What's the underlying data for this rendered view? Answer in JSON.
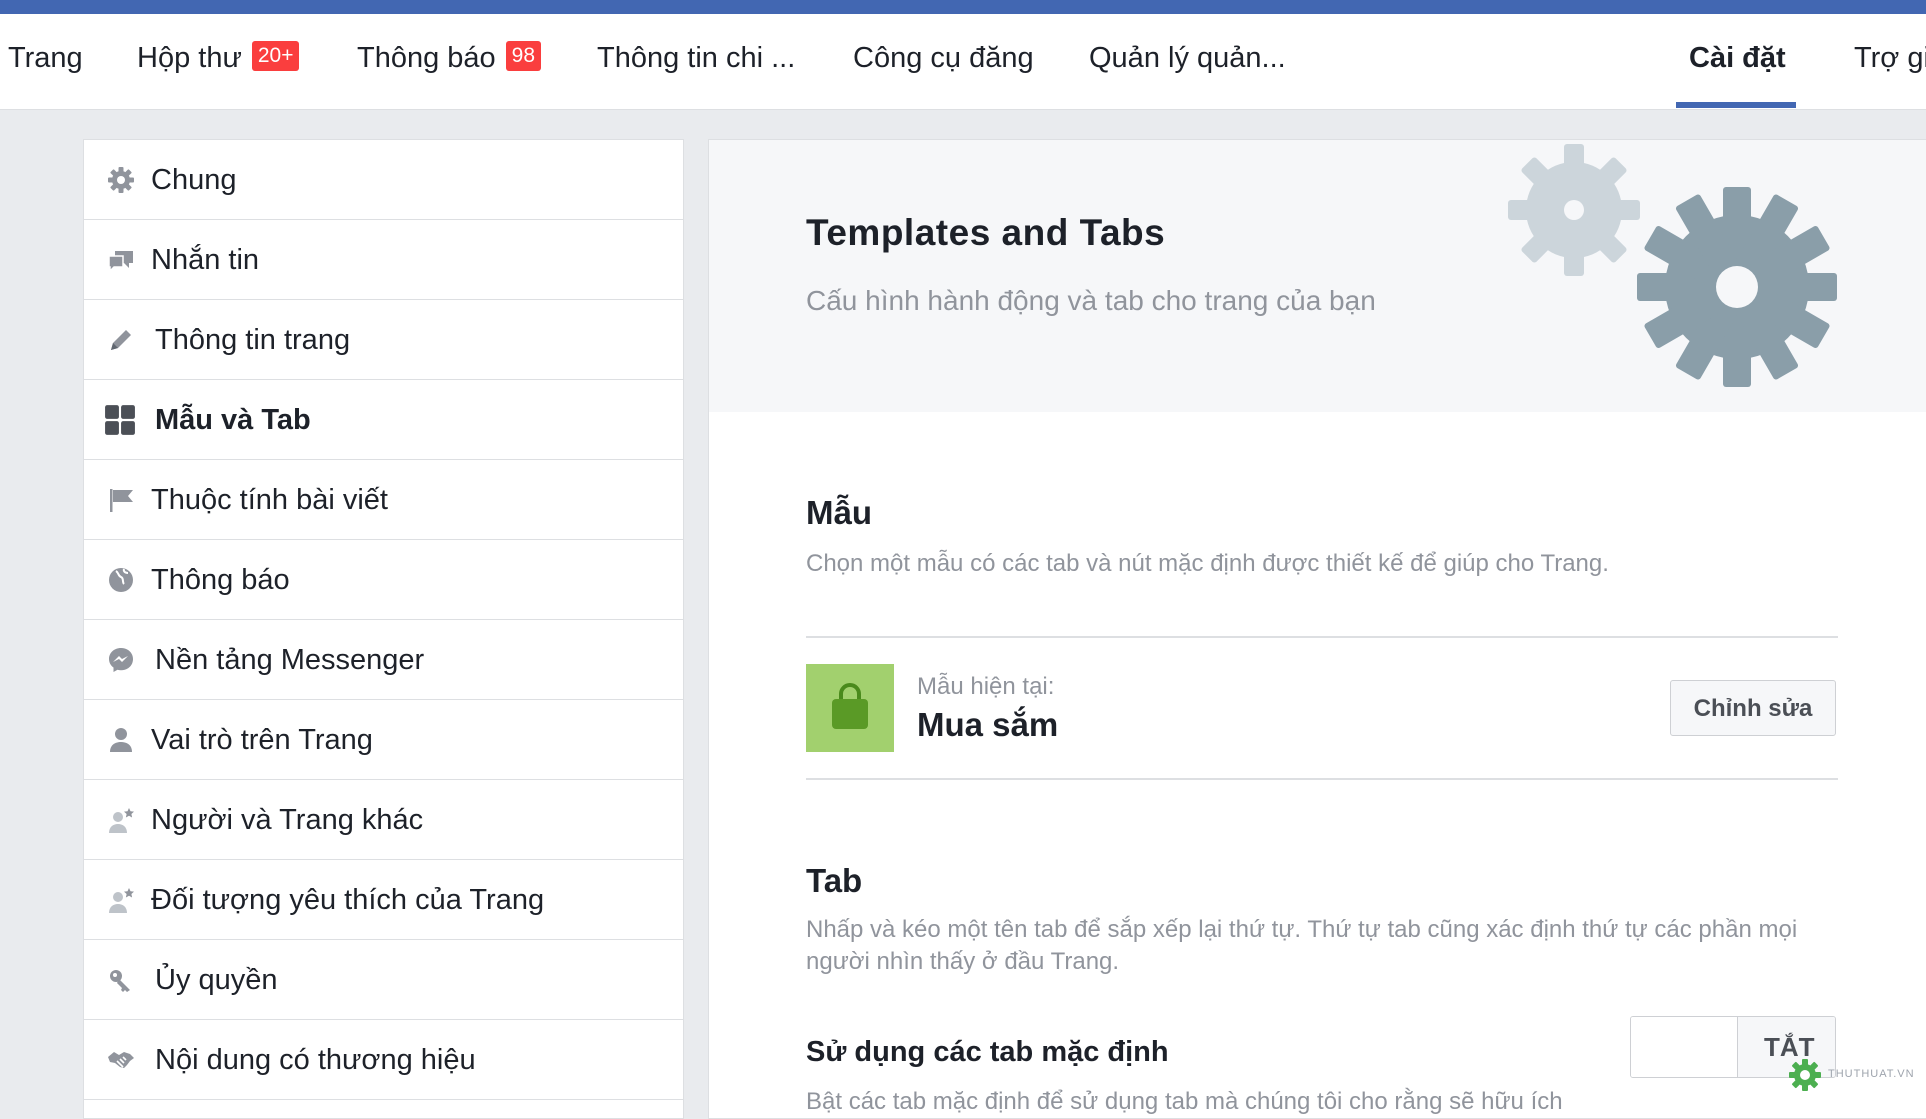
{
  "nav": {
    "items": [
      {
        "label": "Trang"
      },
      {
        "label": "Hộp thư",
        "badge": "20+"
      },
      {
        "label": "Thông báo",
        "badge": "98"
      },
      {
        "label": "Thông tin chi ..."
      },
      {
        "label": "Công cụ đăng"
      },
      {
        "label": "Quản lý quản..."
      },
      {
        "label": "Cài đặt",
        "active": true
      },
      {
        "label": "Trợ gi"
      }
    ]
  },
  "sidebar": {
    "items": [
      {
        "label": "Chung",
        "icon": "gear-icon"
      },
      {
        "label": "Nhắn tin",
        "icon": "chat-bubbles-icon"
      },
      {
        "label": "Thông tin trang",
        "icon": "pencil-icon"
      },
      {
        "label": "Mẫu và Tab",
        "icon": "grid-icon",
        "active": true
      },
      {
        "label": "Thuộc tính bài viết",
        "icon": "flag-icon"
      },
      {
        "label": "Thông báo",
        "icon": "globe-icon"
      },
      {
        "label": "Nền tảng Messenger",
        "icon": "messenger-icon"
      },
      {
        "label": "Vai trò trên Trang",
        "icon": "person-icon"
      },
      {
        "label": "Người và Trang khác",
        "icon": "person-star-icon"
      },
      {
        "label": "Đối tượng yêu thích của Trang",
        "icon": "person-star-icon"
      },
      {
        "label": "Ủy quyền",
        "icon": "key-icon"
      },
      {
        "label": "Nội dung có thương hiệu",
        "icon": "handshake-icon"
      }
    ]
  },
  "hero": {
    "title": "Templates and Tabs",
    "subtitle": "Cấu hình hành động và tab cho trang của bạn"
  },
  "templates": {
    "title": "Mẫu",
    "description": "Chọn một mẫu có các tab và nút mặc định được thiết kế để giúp cho Trang.",
    "current_caption": "Mẫu hiện tại:",
    "current_name": "Mua sắm",
    "edit_button": "Chỉnh sửa"
  },
  "tabs": {
    "title": "Tab",
    "description": "Nhấp và kéo một tên tab để sắp xếp lại thứ tự. Thứ tự tab cũng xác định thứ tự các phần mọi người nhìn thấy ở đầu Trang.",
    "default_tabs_title": "Sử dụng các tab mặc định",
    "default_tabs_desc": "Bật các tab mặc định để sử dụng tab mà chúng tôi cho rằng sẽ hữu ích",
    "toggle_label": "TẮT"
  },
  "watermark": {
    "text": "THUTHUAT.VN"
  },
  "colors": {
    "brand": "#4267b2",
    "badge": "#fa3e3e",
    "template_thumb": "#a2d06e",
    "gear_light": "#ccd5db",
    "gear_dark": "#8a9ea9"
  }
}
